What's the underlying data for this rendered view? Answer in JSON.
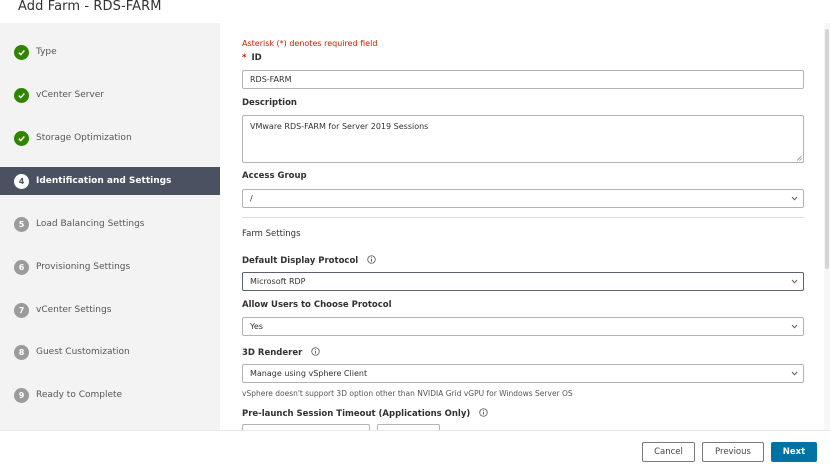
{
  "window": {
    "title": "Add Farm - RDS-FARM"
  },
  "steps": [
    {
      "number": "",
      "label": "Type",
      "state": "done"
    },
    {
      "number": "",
      "label": "vCenter Server",
      "state": "done"
    },
    {
      "number": "",
      "label": "Storage Optimization",
      "state": "done"
    },
    {
      "number": "4",
      "label": "Identification and Settings",
      "state": "active"
    },
    {
      "number": "5",
      "label": "Load Balancing Settings",
      "state": "pending"
    },
    {
      "number": "6",
      "label": "Provisioning Settings",
      "state": "pending"
    },
    {
      "number": "7",
      "label": "vCenter Settings",
      "state": "pending"
    },
    {
      "number": "8",
      "label": "Guest Customization",
      "state": "pending"
    },
    {
      "number": "9",
      "label": "Ready to Complete",
      "state": "pending"
    }
  ],
  "form": {
    "required_note": "Asterisk (*) denotes required field",
    "id_star": "*",
    "id_label": "ID",
    "id_value": "RDS-FARM",
    "description_label": "Description",
    "description_value": "VMware RDS-FARM for Server 2019 Sessions",
    "access_group_label": "Access Group",
    "access_group_value": "/",
    "farm_settings_title": "Farm Settings",
    "display_protocol_label": "Default Display Protocol",
    "display_protocol_value": "Microsoft RDP",
    "allow_choose_label": "Allow Users to Choose Protocol",
    "allow_choose_value": "Yes",
    "renderer_label": "3D Renderer",
    "renderer_value": "Manage using vSphere Client",
    "renderer_help": "vSphere doesn't support 3D option other than NVIDIA Grid vGPU for Windows Server OS",
    "prelaunch_label": "Pre-launch Session Timeout (Applications Only)"
  },
  "footer": {
    "cancel_label": "Cancel",
    "previous_label": "Previous",
    "next_label": "Next"
  },
  "colors": {
    "accent": "#0072a3",
    "active_step": "#4a5262",
    "done": "#2f8400",
    "required": "#c92100"
  },
  "icons": [
    "check-icon",
    "info-icon",
    "chevron-down-icon",
    "resize-handle-icon"
  ]
}
